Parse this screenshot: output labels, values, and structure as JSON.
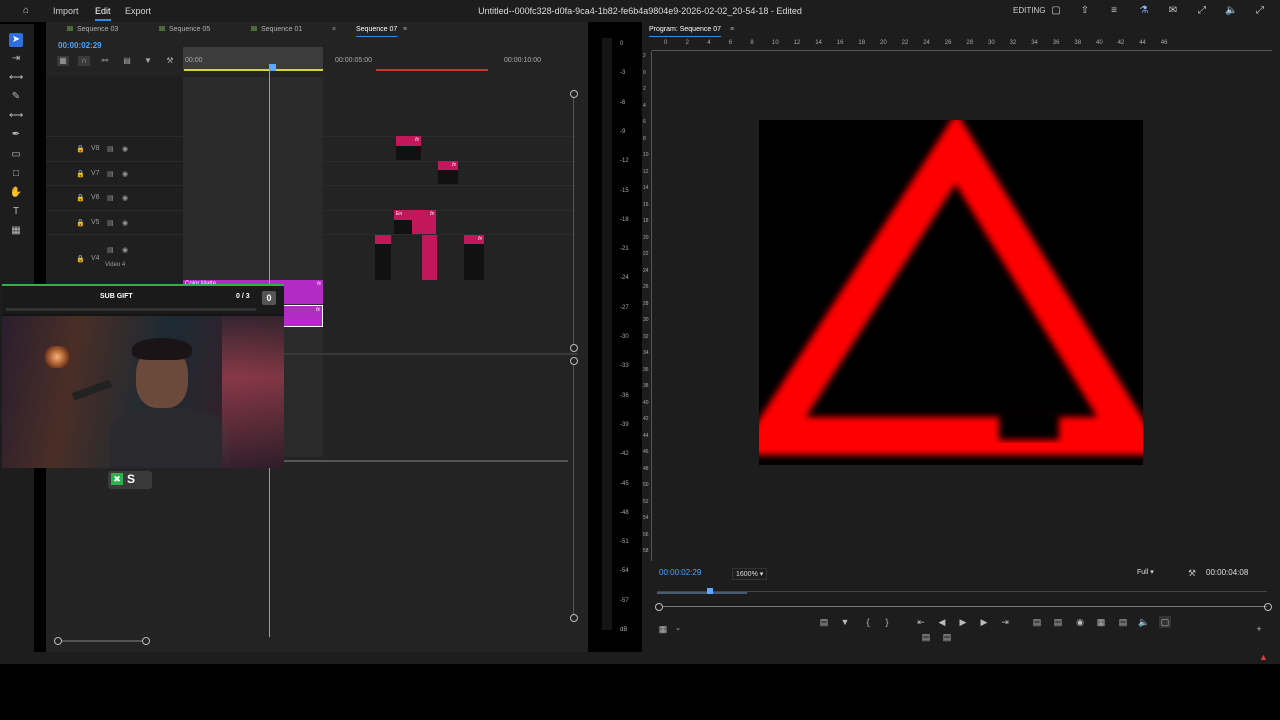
{
  "menu": {
    "import": "Import",
    "edit": "Edit",
    "export": "Export"
  },
  "document_title": "Untitled--000fc328-d0fa-9ca4-1b82-fe6b4a9804e9-2026-02-02_20-54-18 - Edited",
  "workspace": "EDITING",
  "timeline": {
    "tabs": [
      "Sequence 03",
      "Sequence 05",
      "Sequence 01",
      "Sequence 07"
    ],
    "active_tab": "Sequence 07",
    "timecode": "00:00:02:29",
    "ruler_labels": [
      "00:00",
      "00:00:05:00",
      "00:00:10:00"
    ],
    "tracks": [
      {
        "name": "V8"
      },
      {
        "name": "V7"
      },
      {
        "name": "V6"
      },
      {
        "name": "V5"
      },
      {
        "name": "V4",
        "label": "Video 4"
      }
    ],
    "clip_labels": {
      "fx": "fx",
      "color_matte": "Color Matte",
      "en": "En"
    }
  },
  "overlay": {
    "sub_gift_label": "SUB GIFT",
    "sub_gift_count": "0 / 3",
    "sub_gift_badge": "0",
    "sub_gift_progress": 0
  },
  "meter": {
    "db_labels": [
      "0",
      "-3",
      "-6",
      "-9",
      "-12",
      "-15",
      "-18",
      "-21",
      "-24",
      "-27",
      "-30",
      "-33",
      "-36",
      "-39",
      "-42",
      "-45",
      "-48",
      "-51",
      "-54",
      "-57",
      "dB"
    ]
  },
  "program": {
    "title": "Program: Sequence 07",
    "ruler_labels": [
      "0",
      "2",
      "4",
      "6",
      "8",
      "10",
      "12",
      "14",
      "16",
      "18",
      "20",
      "22",
      "24",
      "26",
      "28",
      "30",
      "32",
      "34",
      "36",
      "38",
      "40",
      "42",
      "44",
      "46"
    ],
    "vruler_labels": [
      "2",
      "0",
      "2",
      "4",
      "6",
      "8",
      "10",
      "12",
      "14",
      "16",
      "18",
      "20",
      "22",
      "24",
      "26",
      "28",
      "30",
      "32",
      "34",
      "36",
      "38",
      "40",
      "42",
      "44",
      "46",
      "48",
      "50",
      "52",
      "54",
      "56",
      "58"
    ],
    "timecode": "00:00:02:29",
    "zoom": "1600%",
    "resolution": "Full",
    "duration": "00:00:04:08"
  },
  "colors": {
    "accent": "#2d8ceb",
    "timecode": "#4da3ff",
    "clip_pink": "#c2185b",
    "clip_purple": "#b42ac4",
    "triangle": "#ff0000",
    "playhead": "#5aa9ff"
  }
}
